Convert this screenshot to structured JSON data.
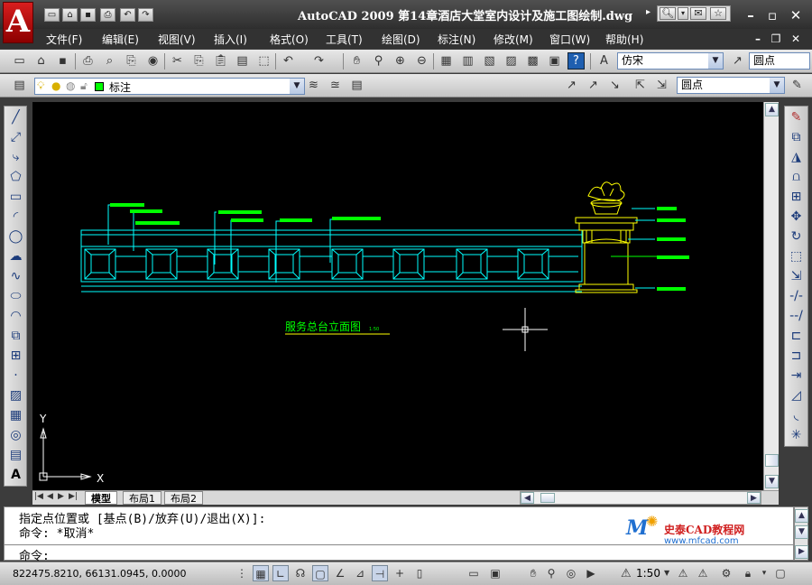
{
  "title": "AutoCAD 2009  第14章酒店大堂室内设计及施工图绘制.dwg",
  "menu": [
    "文件(F)",
    "编辑(E)",
    "视图(V)",
    "插入(I)",
    "格式(O)",
    "工具(T)",
    "绘图(D)",
    "标注(N)",
    "修改(M)",
    "窗口(W)",
    "帮助(H)"
  ],
  "text_style": "仿宋",
  "dim_style": "圆点",
  "layer": "标注",
  "mleader_style": "圆点",
  "drawing_caption": "服务总台立面图",
  "drawing_scale_note": "1:50",
  "axis_y": "Y",
  "axis_x": "X",
  "tabs": [
    "模型",
    "布局1",
    "布局2"
  ],
  "cmd_history": [
    "指定点位置或 [基点(B)/放弃(U)/退出(X)]:",
    "命令: *取消*"
  ],
  "cmd_prompt": "命令:",
  "watermark_title": "史泰CAD教程网",
  "watermark_url": "www.mfcad.com",
  "coords": "822475.8210,  66131.0945,  0.0000",
  "annotation_scale": "1:50",
  "colors": {
    "cyan": "#00ffff",
    "green": "#00ff00",
    "yellow": "#ffff00",
    "white": "#ffffff"
  }
}
